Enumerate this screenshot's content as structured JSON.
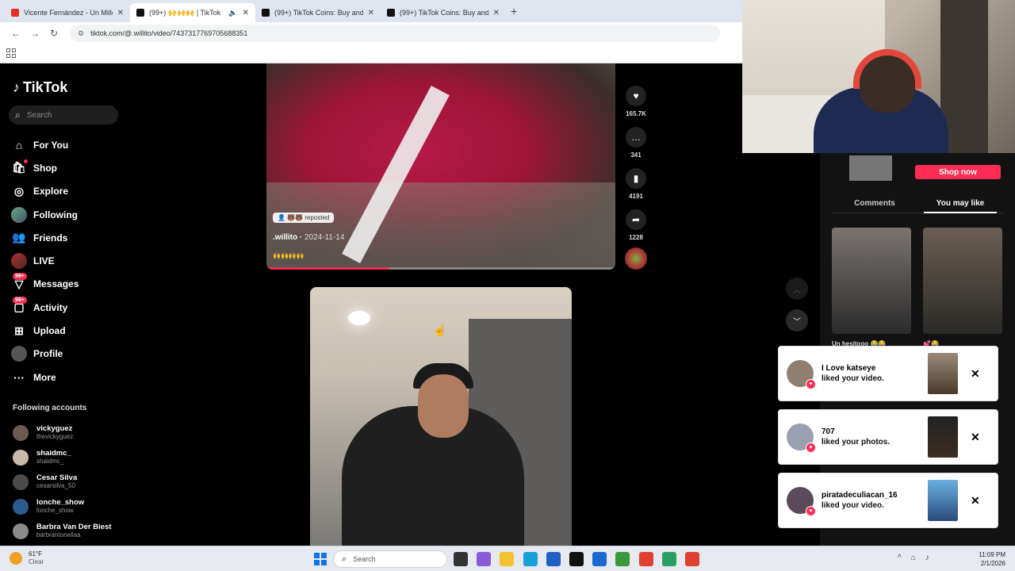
{
  "browser": {
    "tabs": [
      {
        "title": "Vicente Fernández - Un Millón",
        "favicon": "youtube-icon",
        "active": false
      },
      {
        "title": "(99+) 🙌🙌🙌 | TikTok",
        "favicon": "tiktok-icon",
        "active": true
      },
      {
        "title": "(99+) TikTok Coins: Buy and rech",
        "favicon": "tiktok-icon",
        "active": false
      },
      {
        "title": "(99+) TikTok Coins: Buy and rech",
        "favicon": "tiktok-icon",
        "active": false
      }
    ],
    "url": "tiktok.com/@.willito/video/7437317769705688351"
  },
  "sidebar": {
    "logo": "TikTok",
    "search_placeholder": "Search",
    "nav": [
      {
        "label": "For You",
        "icon": "home-icon"
      },
      {
        "label": "Shop",
        "icon": "shop-icon"
      },
      {
        "label": "Explore",
        "icon": "compass-icon"
      },
      {
        "label": "Following",
        "icon": "following-avatar-icon"
      },
      {
        "label": "Friends",
        "icon": "friends-icon"
      },
      {
        "label": "LIVE",
        "icon": "live-icon"
      },
      {
        "label": "Messages",
        "icon": "messages-icon",
        "badge": "99+"
      },
      {
        "label": "Activity",
        "icon": "activity-icon",
        "badge": "99+"
      },
      {
        "label": "Upload",
        "icon": "upload-icon"
      },
      {
        "label": "Profile",
        "icon": "profile-icon"
      },
      {
        "label": "More",
        "icon": "more-icon"
      }
    ],
    "following_title": "Following accounts",
    "accounts": [
      {
        "name": "vickyguez",
        "handle": "thevickyguez"
      },
      {
        "name": "shaidmc_",
        "handle": "shaidmc_"
      },
      {
        "name": "Cesar Silva",
        "handle": "cesarsilva_50"
      },
      {
        "name": "lonche_show",
        "handle": "lonche_show"
      },
      {
        "name": "Barbra Van Der Biest",
        "handle": "barbrantonellaa"
      }
    ]
  },
  "video1": {
    "reposted": "reposted",
    "author": ".willito",
    "date": "2024-11-14",
    "emojis": "🙌🙌🙌🙌",
    "progress": 0.35,
    "actions": [
      {
        "icon": "heart-icon",
        "count": "165.7K"
      },
      {
        "icon": "comment-icon",
        "count": "341"
      },
      {
        "icon": "bookmark-icon",
        "count": "4191"
      },
      {
        "icon": "share-icon",
        "count": "1228"
      }
    ]
  },
  "right_panel": {
    "shop_button": "Shop now",
    "tabs": [
      {
        "label": "Comments",
        "active": false
      },
      {
        "label": "You may like",
        "active": true
      }
    ],
    "thumb_caption": "Un hesitooo 😂😂",
    "thumb_caption2": "💕😂"
  },
  "notifications": [
    {
      "name": "I Love katseye",
      "message": "liked your video."
    },
    {
      "name": "707",
      "message": "liked your photos."
    },
    {
      "name": "piratadeculiacan_16",
      "message": "liked your video."
    }
  ],
  "taskbar": {
    "weather_temp": "61°F",
    "weather_desc": "Clear",
    "search_placeholder": "Search",
    "time": "11:09 PM",
    "date": "2/1/2026"
  }
}
